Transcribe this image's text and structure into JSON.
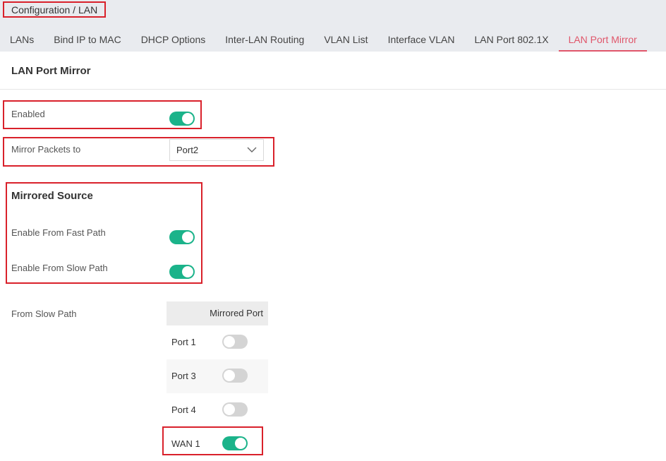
{
  "breadcrumb": "Configuration / LAN",
  "tabs": [
    {
      "label": "LANs",
      "active": false
    },
    {
      "label": "Bind IP to MAC",
      "active": false
    },
    {
      "label": "DHCP Options",
      "active": false
    },
    {
      "label": "Inter-LAN Routing",
      "active": false
    },
    {
      "label": "VLAN List",
      "active": false
    },
    {
      "label": "Interface VLAN",
      "active": false
    },
    {
      "label": "LAN Port 802.1X",
      "active": false
    },
    {
      "label": "LAN Port Mirror",
      "active": true
    }
  ],
  "page": {
    "title": "LAN Port Mirror",
    "enabled": {
      "label": "Enabled",
      "on": true
    },
    "mirror_packets_to": {
      "label": "Mirror Packets to",
      "value": "Port2"
    },
    "mirrored_source": {
      "title": "Mirrored Source",
      "fast_path": {
        "label": "Enable From Fast Path",
        "on": true
      },
      "slow_path": {
        "label": "Enable From Slow Path",
        "on": true
      }
    },
    "from_slow_path": {
      "label": "From Slow Path",
      "column_header": "Mirrored Port",
      "ports": [
        {
          "name": "Port 1",
          "on": false
        },
        {
          "name": "Port 3",
          "on": false
        },
        {
          "name": "Port 4",
          "on": false
        },
        {
          "name": "WAN 1",
          "on": true
        }
      ]
    }
  },
  "colors": {
    "accent": "#e0566a",
    "toggle_on": "#1bb38a",
    "toggle_off": "#d4d4d4",
    "highlight": "#d9212b"
  },
  "icons": {
    "select": "chevron-down-icon"
  }
}
